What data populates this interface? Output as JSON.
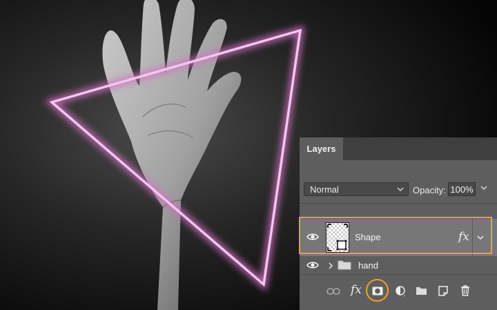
{
  "panel": {
    "tab_label": "Layers",
    "blend_mode": "Normal",
    "opacity_label": "Opacity:",
    "opacity_value": "100%"
  },
  "layers": [
    {
      "name": "Shape",
      "type": "shape",
      "visible": true,
      "selected": true,
      "has_effects": true,
      "effects_label": "fx"
    },
    {
      "name": "hand",
      "type": "group",
      "visible": true,
      "selected": false,
      "expanded": false
    }
  ],
  "bottom_toolbar": {
    "fx_label": "fx",
    "icons": [
      "link-icon",
      "fx-icon",
      "add-mask-icon",
      "adjustment-layer-icon",
      "new-group-icon",
      "new-layer-icon",
      "trash-icon"
    ]
  },
  "highlight": {
    "color": "#f4a12c",
    "targets": [
      "layer-row-shape",
      "add-mask-button"
    ]
  },
  "colors": {
    "neon_triangle": "#f3c6ef",
    "neon_glow": "#d36fc4",
    "panel_bg": "#5e5e5e",
    "selected_row": "#777777"
  }
}
